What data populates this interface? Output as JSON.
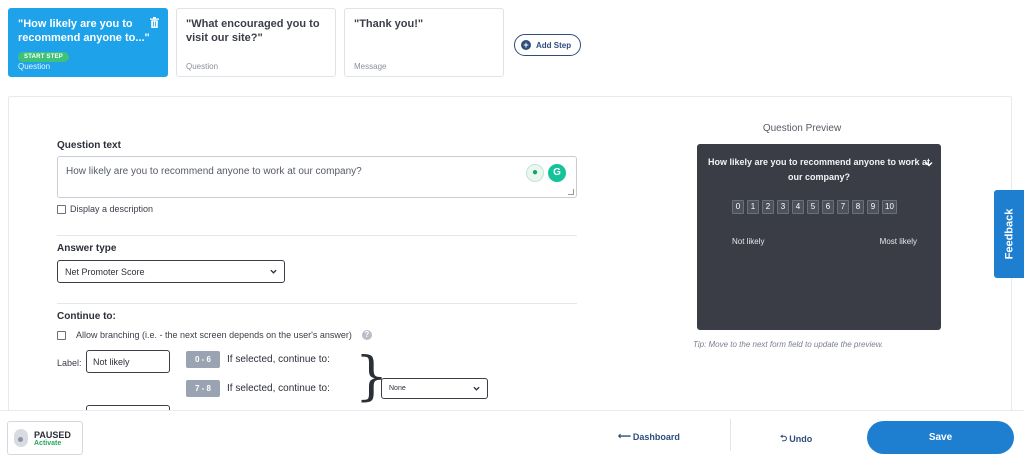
{
  "steps": [
    {
      "title": "\"How likely are you to recommend anyone to...\"",
      "badge": "START STEP",
      "type": "Question",
      "active": true
    },
    {
      "title": "\"What encouraged you to visit our site?\"",
      "type": "Question",
      "active": false
    },
    {
      "title": "\"Thank you!\"",
      "type": "Message",
      "active": false
    }
  ],
  "add_step_label": "Add Step",
  "form": {
    "question_label": "Question text",
    "question_value": "How likely are you to recommend anyone to work at our company?",
    "display_description": "Display a description",
    "answer_type_label": "Answer type",
    "answer_type_value": "Net Promoter Score",
    "continue_label": "Continue to:",
    "allow_branching": "Allow branching (i.e. - the next screen depends on the user's answer)",
    "label_text": "Label:",
    "label_low_value": "Not likely",
    "ranges": [
      "0 - 6",
      "7 - 8"
    ],
    "if_selected": "If selected, continue to:",
    "continue_select_value": "None"
  },
  "preview": {
    "title": "Question Preview",
    "question": "How likely are you to recommend anyone to work at our company?",
    "scale": [
      "0",
      "1",
      "2",
      "3",
      "4",
      "5",
      "6",
      "7",
      "8",
      "9",
      "10"
    ],
    "low_label": "Not likely",
    "high_label": "Most likely",
    "tip": "Tip: Move to the next form field to update the preview."
  },
  "feedback_label": "Feedback",
  "bottom": {
    "status": "PAUSED",
    "status_action": "Activate",
    "dashboard": "Dashboard",
    "undo": "Undo",
    "save": "Save"
  },
  "colors": {
    "accent": "#1e7fd1",
    "step_active": "#1ea2ea",
    "preview_bg": "#3a3d46",
    "start_badge": "#3ec27a"
  }
}
